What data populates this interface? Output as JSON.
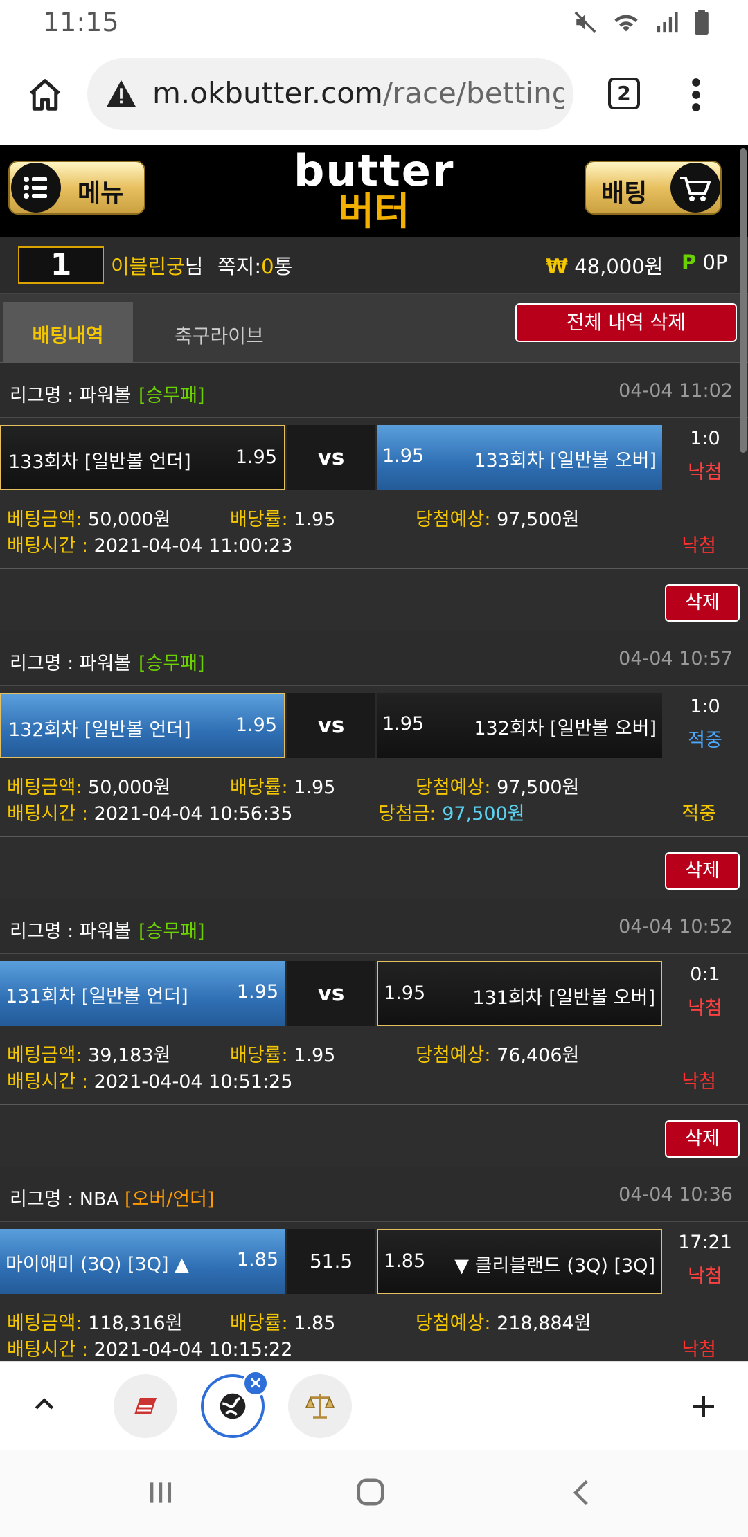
{
  "status": {
    "time": "11:15"
  },
  "browser": {
    "url_host": "m.okbutter.com",
    "url_path": "/race/betting",
    "tab_count": "2"
  },
  "header": {
    "menu_label": "메뉴",
    "bet_label": "배팅",
    "logo_en": "butter",
    "logo_ko": "버터"
  },
  "user": {
    "rank": "1",
    "name": "이블린궁",
    "name_suffix": "님",
    "msg_label": "쪽지:",
    "msg_count": "0",
    "msg_unit": "통",
    "money_symbol": "₩",
    "money": "48,000원",
    "points_symbol": "P",
    "points": "0P"
  },
  "tabs": {
    "history": "배팅내역",
    "live": "축구라이브",
    "delete_all": "전체 내역 삭제"
  },
  "labels": {
    "league": "리그명 : ",
    "vs": "vs",
    "bet_amount": "베팅금액:",
    "odds": "배당률:",
    "expected": "당첨예상:",
    "bet_time": "배팅시간 :",
    "win_amount": "당첨금:",
    "delete": "삭제"
  },
  "bets": [
    {
      "league": "파워볼",
      "type": "[승무패]",
      "datetime": "04-04 11:02",
      "home": "133회차 [일반볼 언더]",
      "home_odd": "1.95",
      "away": "133회차 [일반볼 오버]",
      "away_odd": "1.95",
      "score": "1:0",
      "result": "낙첨",
      "amount": "50,000원",
      "odds": "1.95",
      "expected": "97,500원",
      "time": "2021-04-04 11:00:23",
      "status": "낙첨"
    },
    {
      "league": "파워볼",
      "type": "[승무패]",
      "datetime": "04-04 10:57",
      "home": "132회차 [일반볼 언더]",
      "home_odd": "1.95",
      "away": "132회차 [일반볼 오버]",
      "away_odd": "1.95",
      "score": "1:0",
      "result": "적중",
      "amount": "50,000원",
      "odds": "1.95",
      "expected": "97,500원",
      "time": "2021-04-04 10:56:35",
      "win_amount": "97,500원",
      "status": "적중"
    },
    {
      "league": "파워볼",
      "type": "[승무패]",
      "datetime": "04-04 10:52",
      "home": "131회차 [일반볼 언더]",
      "home_odd": "1.95",
      "away": "131회차 [일반볼 오버]",
      "away_odd": "1.95",
      "score": "0:1",
      "result": "낙첨",
      "amount": "39,183원",
      "odds": "1.95",
      "expected": "76,406원",
      "time": "2021-04-04 10:51:25",
      "status": "낙첨"
    },
    {
      "league": "NBA",
      "type": "[오버/언더]",
      "datetime": "04-04 10:36",
      "home": "마이애미 (3Q) [3Q] ▲",
      "home_odd": "1.85",
      "center": "51.5",
      "away": "▼ 클리블랜드 (3Q) [3Q]",
      "away_odd": "1.85",
      "score": "17:21",
      "result": "낙첨",
      "amount": "118,316원",
      "odds": "1.85",
      "expected": "218,884원",
      "time": "2021-04-04 10:15:22",
      "status": "낙첨"
    }
  ]
}
